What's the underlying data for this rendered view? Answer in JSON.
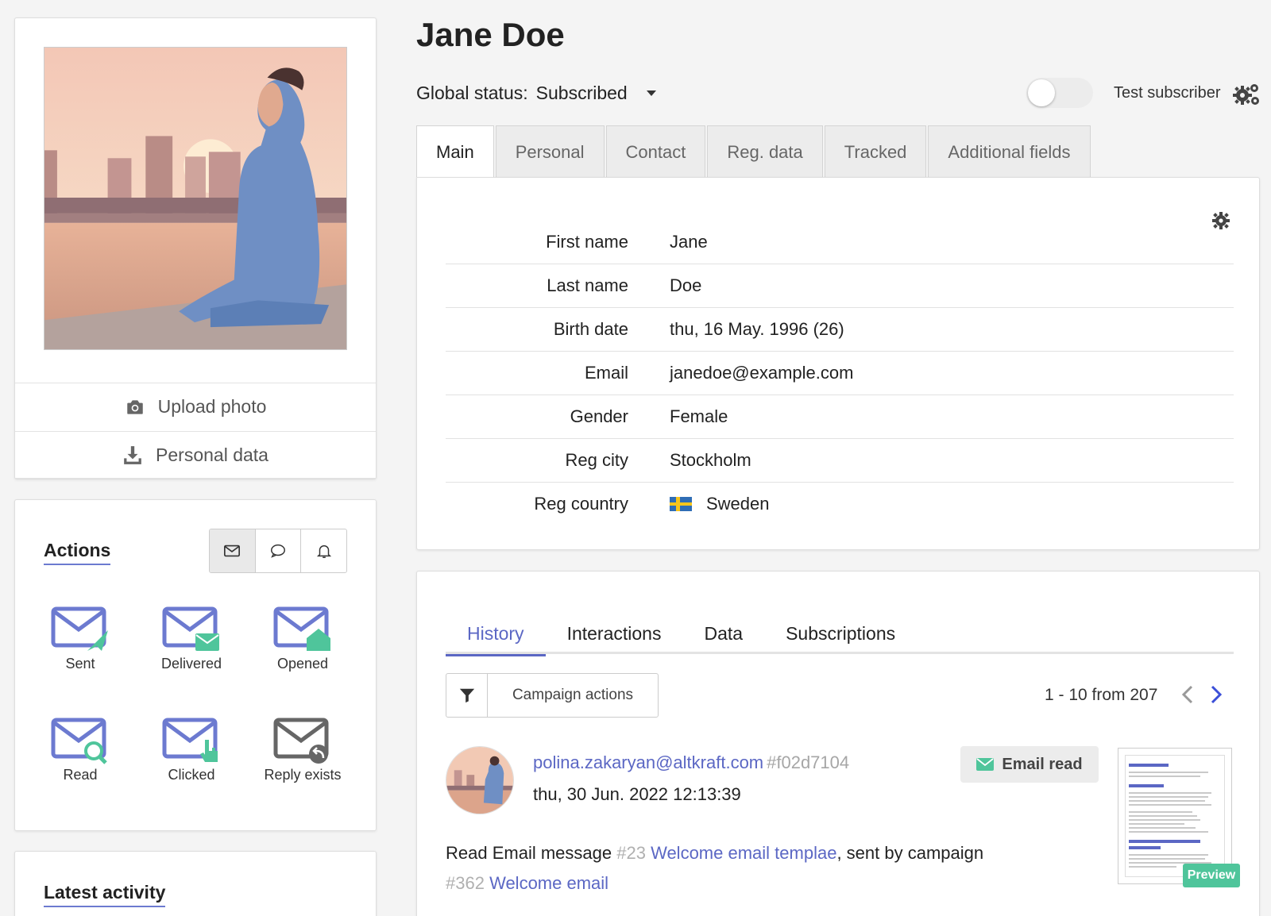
{
  "profile": {
    "name": "Jane Doe",
    "global_status_label": "Global status:",
    "global_status_value": "Subscribed",
    "test_subscriber_label": "Test subscriber",
    "upload_photo_label": "Upload photo",
    "personal_data_label": "Personal data"
  },
  "tabs": [
    "Main",
    "Personal",
    "Contact",
    "Reg. data",
    "Tracked",
    "Additional fields"
  ],
  "fields": [
    {
      "label": "First name",
      "value": "Jane"
    },
    {
      "label": "Last name",
      "value": "Doe"
    },
    {
      "label": "Birth date",
      "value": "thu, 16 May. 1996 (26)"
    },
    {
      "label": "Email",
      "value": "janedoe@example.com"
    },
    {
      "label": "Gender",
      "value": "Female"
    },
    {
      "label": "Reg city",
      "value": "Stockholm"
    },
    {
      "label": "Reg country",
      "value": "Sweden"
    }
  ],
  "actions": {
    "title": "Actions",
    "items": [
      "Sent",
      "Delivered",
      "Opened",
      "Read",
      "Clicked",
      "Reply exists"
    ]
  },
  "latest_activity": {
    "title": "Latest activity"
  },
  "history": {
    "tabs": [
      "History",
      "Interactions",
      "Data",
      "Subscriptions"
    ],
    "filter_label": "Campaign actions",
    "pager": "1 - 10 from 207",
    "entry": {
      "email": "polina.zakaryan@altkraft.com",
      "hash": "#f02d7104",
      "date": "thu, 30 Jun. 2022 12:13:39",
      "badge": "Email read",
      "text_prefix": "Read Email message",
      "message_id": "#23",
      "message_name": "Welcome email templae",
      "text_mid": ", sent by campaign",
      "campaign_id": "#362",
      "campaign_name": "Welcome email",
      "preview_label": "Preview"
    }
  },
  "colors": {
    "accent": "#5b67c4",
    "green": "#4fc59b",
    "envelope": "#6c7ad0"
  }
}
